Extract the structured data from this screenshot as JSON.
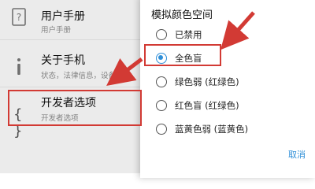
{
  "settings": {
    "items": [
      {
        "title": "用户手册",
        "subtitle": "用户手册",
        "icon": "help-doc-icon"
      },
      {
        "title": "关于手机",
        "subtitle": "状态，法律信息，设备名",
        "icon": "info-icon"
      },
      {
        "title": "开发者选项",
        "subtitle": "开发者选项",
        "icon": "braces-icon"
      }
    ]
  },
  "dialog": {
    "title": "模拟颜色空间",
    "options": [
      {
        "label": "已禁用",
        "selected": false
      },
      {
        "label": "全色盲",
        "selected": true
      },
      {
        "label": "绿色弱 (红绿色)",
        "selected": false
      },
      {
        "label": "红色盲 (红绿色)",
        "selected": false
      },
      {
        "label": "蓝黄色弱 (蓝黄色)",
        "selected": false
      }
    ],
    "cancel_label": "取消"
  },
  "colors": {
    "accent": "#2f8fd8",
    "annotation": "#d23a34"
  }
}
